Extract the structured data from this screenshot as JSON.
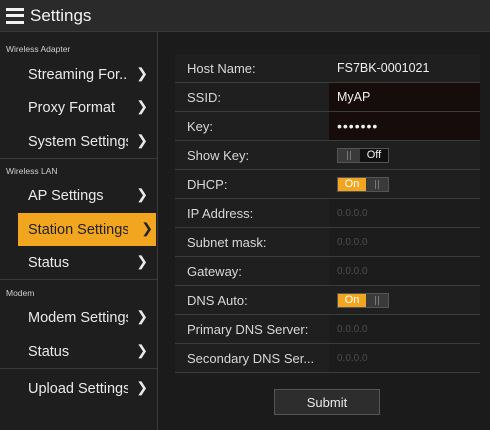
{
  "header": {
    "title": "Settings"
  },
  "sidebar": {
    "sections": [
      {
        "header": "Wireless Adapter",
        "items": [
          {
            "label": "Streaming For..."
          },
          {
            "label": "Proxy Format"
          },
          {
            "label": "System Settings"
          }
        ]
      },
      {
        "header": "Wireless LAN",
        "items": [
          {
            "label": "AP Settings"
          },
          {
            "label": "Station Settings",
            "active": true
          },
          {
            "label": "Status"
          }
        ]
      },
      {
        "header": "Modem",
        "items": [
          {
            "label": "Modem Settings"
          },
          {
            "label": "Status"
          }
        ]
      },
      {
        "header": "",
        "items": [
          {
            "label": "Upload Settings"
          }
        ]
      }
    ]
  },
  "form": {
    "host_name": {
      "label": "Host Name:",
      "value": "FS7BK-0001021"
    },
    "ssid": {
      "label": "SSID:",
      "value": "MyAP"
    },
    "key": {
      "label": "Key:",
      "value": "•••••••"
    },
    "show_key": {
      "label": "Show Key:",
      "state": "Off"
    },
    "dhcp": {
      "label": "DHCP:",
      "state": "On"
    },
    "ip_address": {
      "label": "IP Address:",
      "placeholder": "0.0.0.0"
    },
    "subnet_mask": {
      "label": "Subnet mask:",
      "placeholder": "0.0.0.0"
    },
    "gateway": {
      "label": "Gateway:",
      "placeholder": "0.0.0.0"
    },
    "dns_auto": {
      "label": "DNS Auto:",
      "state": "On"
    },
    "primary_dns": {
      "label": "Primary DNS Server:",
      "placeholder": "0.0.0.0"
    },
    "secondary_dns": {
      "label": "Secondary DNS Ser...",
      "placeholder": "0.0.0.0"
    }
  },
  "submit_label": "Submit",
  "colors": {
    "accent": "#f2a51f",
    "background": "#1b1b1b"
  }
}
